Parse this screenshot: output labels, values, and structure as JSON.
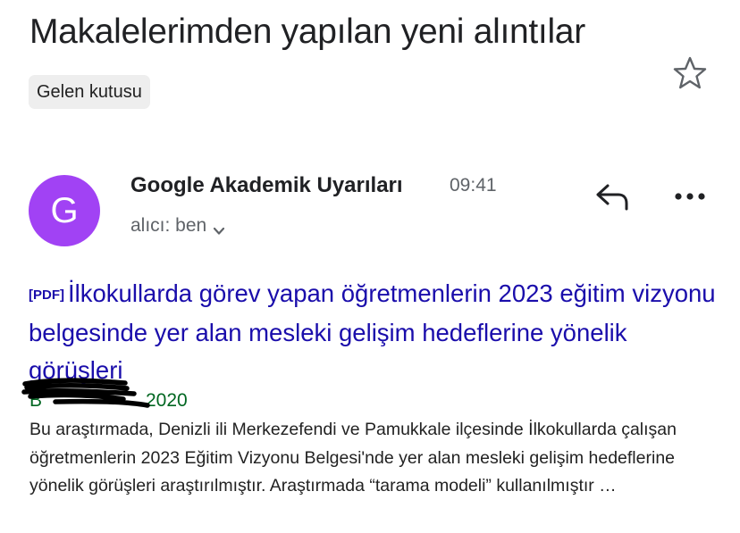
{
  "email": {
    "subject": "Makalelerimden yapılan yeni alıntılar",
    "label": "Gelen kutusu",
    "sender": {
      "name": "Google Akademik Uyarıları",
      "avatar_letter": "G",
      "avatar_color": "#a142f4"
    },
    "time": "09:41",
    "recipient": "alıcı: ben"
  },
  "result": {
    "format_tag": "[PDF]",
    "title": "İlkokullarda görev yapan öğretmenlerin 2023 eğitim vizyonu belgesinde yer alan mesleki gelişim hedeflerine yönelik görüşleri",
    "author_prefix": "B",
    "year": "2020",
    "snippet": "Bu araştırmada, Denizli ili Merkezefendi ve Pamukkale ilçesinde İlkokullarda çalışan öğretmenlerin 2023 Eğitim Vizyonu Belgesi'nde yer alan mesleki gelişim hedeflerine yönelik görüşleri araştırılmıştır. Araştırmada “tarama modeli” kullanılmıştır …"
  },
  "icons": {
    "star": "star-outline-icon",
    "reply": "reply-arrow-icon",
    "more": "more-horizontal-icon",
    "recipient_toggle": "chevron-down-icon"
  },
  "colors": {
    "link": "#1a0dab",
    "author_green": "#006621",
    "secondary_text": "#5f6368"
  }
}
